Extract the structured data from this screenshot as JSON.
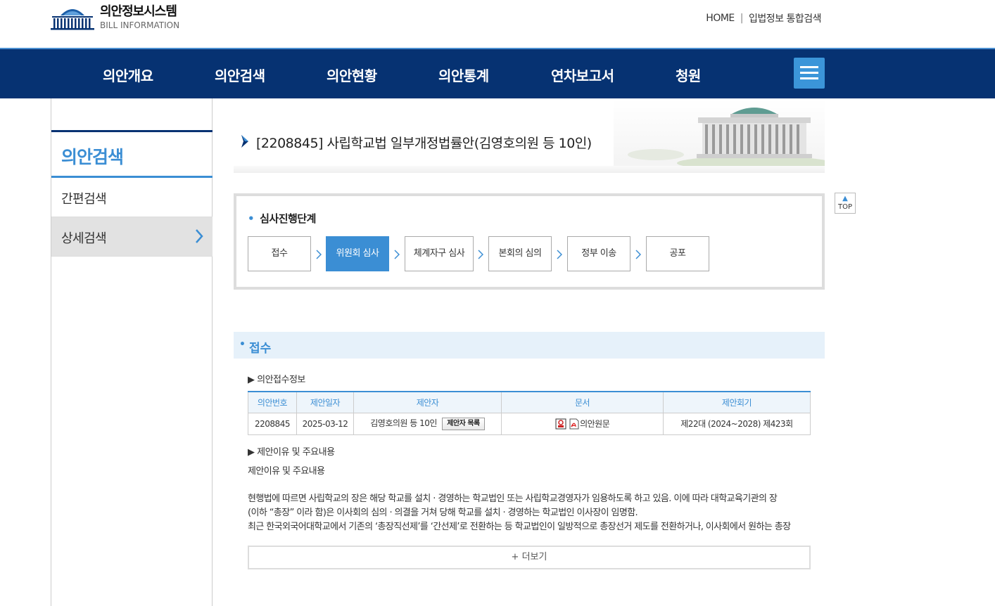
{
  "header": {
    "logo_title": "의안정보시스템",
    "logo_sub": "BILL INFORMATION",
    "links": [
      "HOME",
      "입법정보 통합검색"
    ]
  },
  "nav": {
    "items": [
      "의안개요",
      "의안검색",
      "의안현황",
      "의안통계",
      "연차보고서",
      "청원"
    ]
  },
  "sidebar": {
    "title": "의안검색",
    "items": [
      {
        "label": "간편검색"
      },
      {
        "label": "상세검색"
      }
    ]
  },
  "bill": {
    "title": "[2208845] 사립학교법 일부개정법률안(김영호의원 등 10인)"
  },
  "top_button": "TOP",
  "stage": {
    "heading": "심사진행단계",
    "steps": [
      "접수",
      "위원회 심사",
      "체계자구 심사",
      "본회의 심의",
      "정부 이송",
      "공포"
    ],
    "active_index": 1
  },
  "section": {
    "title": "접수",
    "receipt_label": "▶ 의안접수정보",
    "table": {
      "headers": [
        "의안번호",
        "제안일자",
        "제안자",
        "문서",
        "제안회기"
      ],
      "row": {
        "bill_no": "2208845",
        "date": "2025-03-12",
        "proposer": "김영호의원 등 10인",
        "proposer_button": "제안자 목록",
        "document": "의안원문",
        "session": "제22대 (2024~2028) 제423회"
      }
    },
    "reason_label": "▶ 제안이유 및 주요내용",
    "reason_heading": "제안이유 및 주요내용",
    "reason_lines": [
      "현행법에 따르면 사립학교의 장은 해당 학교를 설치 · 경영하는 학교법인 또는 사립학교경영자가 임용하도록 하고 있음. 이에 따라 대학교육기관의 장",
      "(이하 “총장” 이라 함)은 이사회의 심의 · 의결을 거쳐 당해 학교를 설치 · 경영하는 학교법인 이사장이 임명함.",
      "최근 한국외국어대학교에서 기존의 ‘총장직선제’를 ‘간선제’로 전환하는 등 학교법인이 일방적으로 총장선거 제도를 전환하거나, 이사회에서 원하는 총장"
    ],
    "more_button": "+ 더보기"
  }
}
